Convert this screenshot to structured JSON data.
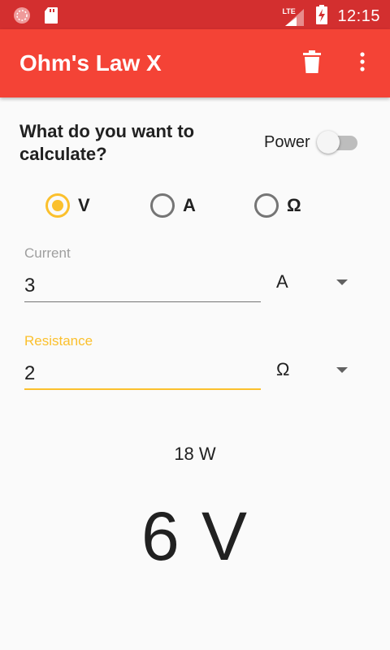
{
  "status_bar": {
    "time": "12:15",
    "network": "LTE",
    "icons": [
      "app-notification-icon",
      "sd-card-icon",
      "lte-signal-icon",
      "battery-charging-icon"
    ]
  },
  "app_bar": {
    "title": "Ohm's Law X",
    "actions": [
      "delete-icon",
      "more-vert-icon"
    ],
    "color": "#f44336",
    "status_color": "#d32f2f"
  },
  "form": {
    "question": "What do you want to calculate?",
    "power_toggle": {
      "label": "Power",
      "on": false
    },
    "options": [
      {
        "label": "V",
        "checked": true
      },
      {
        "label": "A",
        "checked": false
      },
      {
        "label": "Ω",
        "checked": false
      }
    ],
    "current": {
      "label": "Current",
      "value": "3",
      "unit": "A"
    },
    "resistance": {
      "label": "Resistance",
      "value": "2",
      "unit": "Ω"
    },
    "accent": "#fbc02d"
  },
  "result": {
    "power": "18 W",
    "value": "6 V"
  }
}
